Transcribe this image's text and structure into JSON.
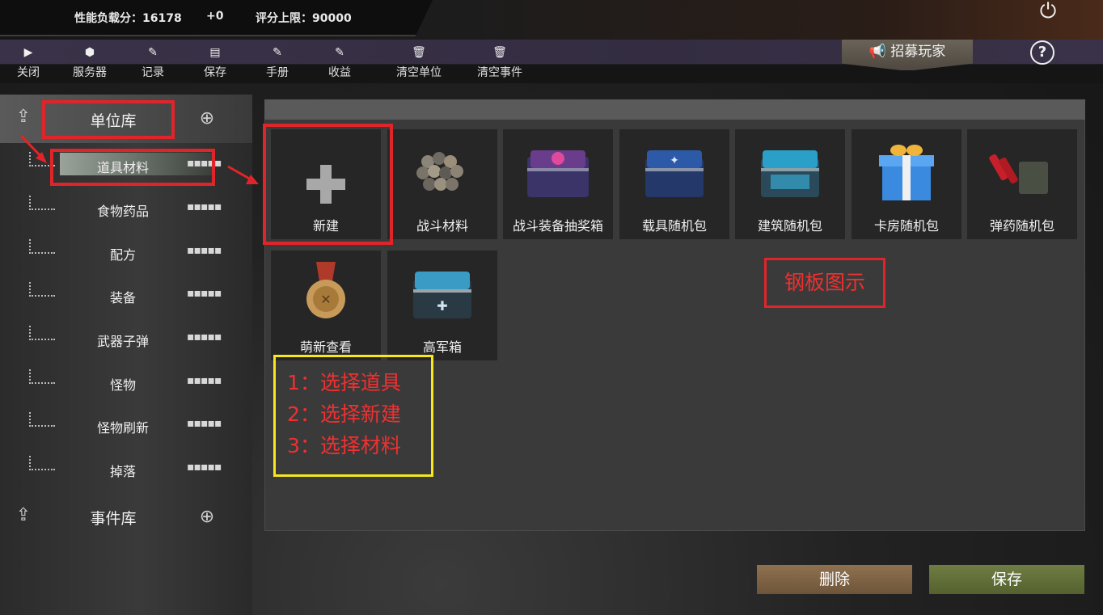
{
  "topbar": {
    "perf_load_label": "性能负载分：16178",
    "perf_delta": "+0",
    "score_limit_label": "评分上限：90000",
    "power_icon": "power-icon"
  },
  "toolbar": {
    "items": [
      {
        "label": "关闭",
        "icon": "play-icon"
      },
      {
        "label": "服务器",
        "icon": "cube-icon"
      },
      {
        "label": "记录",
        "icon": "edit-icon"
      },
      {
        "label": "保存",
        "icon": "floppy-icon"
      },
      {
        "label": "手册",
        "icon": "edit-icon"
      },
      {
        "label": "收益",
        "icon": "edit-icon"
      },
      {
        "label": "清空单位",
        "icon": "trash-icon"
      },
      {
        "label": "清空事件",
        "icon": "trash-icon"
      }
    ],
    "recruit_label": "招募玩家",
    "help_label": "?"
  },
  "sidebar": {
    "unit_library_title": "单位库",
    "event_library_title": "事件库",
    "categories": [
      {
        "name": "道具材料"
      },
      {
        "name": "食物药品"
      },
      {
        "name": "配方"
      },
      {
        "name": "装备"
      },
      {
        "name": "武器子弹"
      },
      {
        "name": "怪物"
      },
      {
        "name": "怪物刷新"
      },
      {
        "name": "掉落"
      }
    ],
    "grip_glyph": "▪▪▪▪▪"
  },
  "main": {
    "tiles": [
      {
        "name": "新建",
        "icon": "plus-icon"
      },
      {
        "name": "战斗材料",
        "icon": "stones-icon"
      },
      {
        "name": "战斗装备抽奖箱",
        "icon": "lootbox-purple-icon"
      },
      {
        "name": "载具随机包",
        "icon": "lootbox-blue-icon"
      },
      {
        "name": "建筑随机包",
        "icon": "lootbox-cyan-icon"
      },
      {
        "name": "卡房随机包",
        "icon": "gift-box-icon"
      },
      {
        "name": "弹药随机包",
        "icon": "ammo-crate-icon"
      },
      {
        "name": "萌新查看",
        "icon": "medal-icon"
      },
      {
        "name": "高军箱",
        "icon": "lootbox-teal-icon"
      }
    ],
    "delete_label": "删除",
    "save_label": "保存"
  },
  "annotations": {
    "steel_note": "钢板图示",
    "steps": [
      "1：选择道具",
      "2：选择新建",
      "3：选择材料"
    ],
    "highlight_color": "#e0252a",
    "steps_border_color": "#f6e81c"
  }
}
